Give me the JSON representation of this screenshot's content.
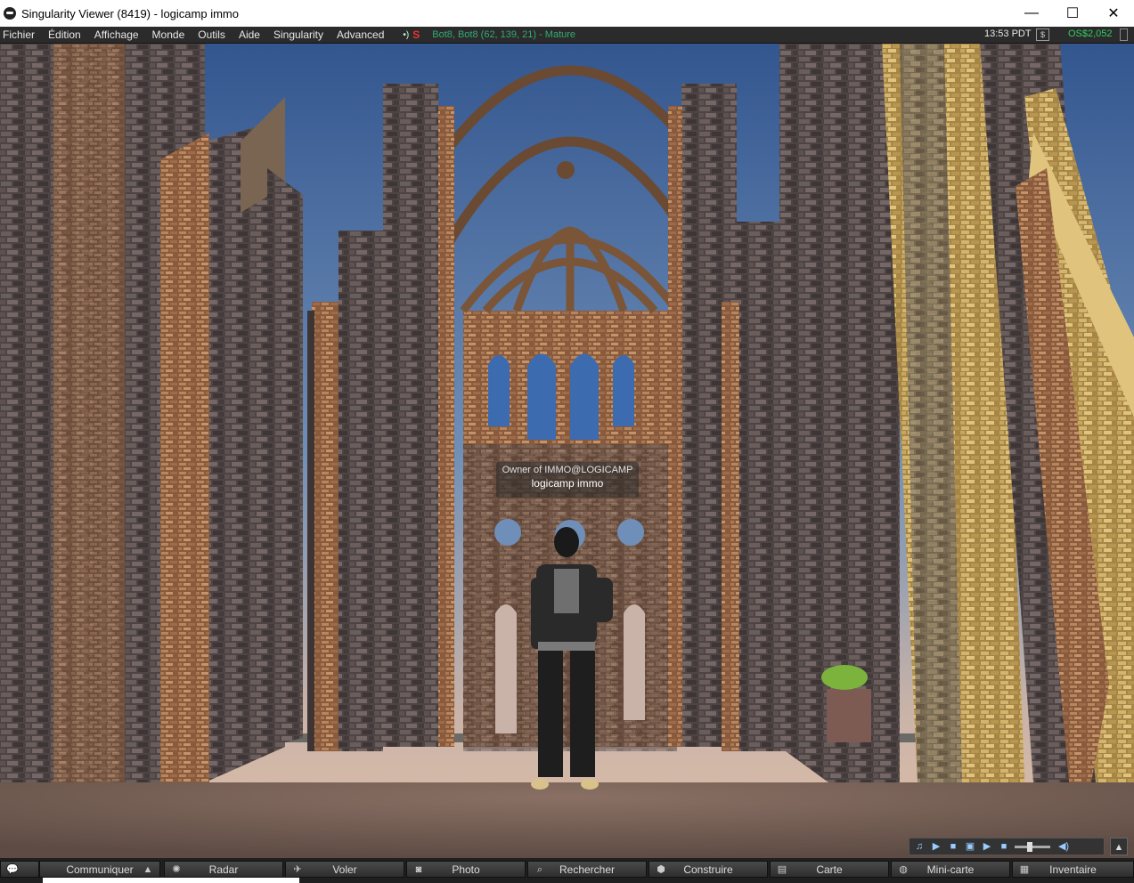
{
  "window": {
    "title": "Singularity Viewer (8419) - logicamp immo",
    "controls": {
      "minimize": "—",
      "maximize": "☐",
      "close": "✕"
    }
  },
  "menu": {
    "items": [
      "Fichier",
      "Édition",
      "Affichage",
      "Monde",
      "Outils",
      "Aide",
      "Singularity",
      "Advanced"
    ],
    "sound_indicator": "•)",
    "script_indicator": "S",
    "location": "Bot8, Bot8 (62, 139, 21) - Mature",
    "clock": "13:53 PDT",
    "buy_currency_icon": "$",
    "balance": "OS$2,052"
  },
  "avatar_tag": {
    "group": "Owner of IMMO@LOGICAMP",
    "name": "logicamp immo"
  },
  "media_controls": {
    "icons": [
      "music-note-icon",
      "play-icon",
      "stop-icon",
      "media-icon",
      "play-icon",
      "stop-icon",
      "volume-slider",
      "speaker-icon"
    ],
    "expand": "▲"
  },
  "toolbar": {
    "buttons": [
      {
        "label": "Communiquer",
        "icon": "chat-bubble-icon"
      },
      {
        "label": "Radar",
        "icon": "radar-icon"
      },
      {
        "label": "Voler",
        "icon": "fly-icon"
      },
      {
        "label": "Photo",
        "icon": "camera-icon"
      },
      {
        "label": "Rechercher",
        "icon": "search-icon"
      },
      {
        "label": "Construire",
        "icon": "build-cube-icon"
      },
      {
        "label": "Carte",
        "icon": "map-icon"
      },
      {
        "label": "Mini-carte",
        "icon": "minimap-icon"
      },
      {
        "label": "Inventaire",
        "icon": "inventory-icon"
      }
    ]
  },
  "colors": {
    "sky_top": "#3a5f9c",
    "sky_bottom": "#d8b8a4",
    "stone": "#5a4e4a",
    "brick": "#a0704e",
    "ground": "#7a6458",
    "balance_green": "#33cc66",
    "location_green": "#33aa77"
  }
}
